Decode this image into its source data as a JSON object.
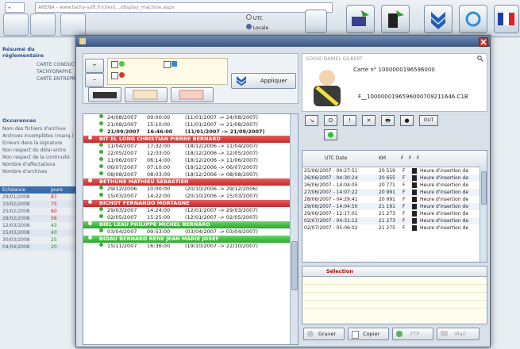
{
  "background": {
    "url_text": "ARENA - www.tachy-soft.fr/client.../display_machine.aspx",
    "utc_label": "UTC",
    "locale_label": "Locale",
    "resume_title": "Résumé du réglementaire",
    "resume_items": [
      "CARTE CONDUCTEUR",
      "TACHYGRAPHE",
      "CARTE ENTREPRISE"
    ],
    "occurrences_title": "Occurences",
    "occurrences_items": [
      "Nom des fichiers d'archive",
      "Archives incomplètes (manq.)",
      "Erreurs dans la signature",
      "Non respect du délai entre",
      "Non respect de la continuité",
      "Nombre d'affectations",
      "Nombre d'archives"
    ],
    "echeance_header": "Echéance",
    "jours_header": "Jours",
    "echeance_rows": [
      {
        "date": "29/01/2008",
        "days": "87"
      },
      {
        "date": "10/02/2008",
        "days": "75"
      },
      {
        "date": "25/02/2008",
        "days": "60"
      },
      {
        "date": "28/02/2008",
        "days": "56"
      },
      {
        "date": "12/03/2008",
        "days": "43"
      },
      {
        "date": "15/03/2008",
        "days": "40"
      },
      {
        "date": "30/03/2008",
        "days": "25"
      },
      {
        "date": "04/04/2008",
        "days": "20"
      }
    ]
  },
  "dialog": {
    "apply_label": "Appliquer",
    "driver_blur_name": "GOSSE DANIEL GILBERT",
    "card_label": "Carte n°",
    "card_number": "1000000196596000",
    "file_name": "F__1000000196596000709211646.C1B",
    "action_buttons": [
      "↘",
      "O",
      "!",
      "✕",
      "🖶",
      "●",
      "OUT"
    ],
    "left_list": [
      {
        "kind": "row",
        "date": "24/08/2007",
        "time": "09:00:00",
        "range": "(11/01/2007 -> 24/08/2007)"
      },
      {
        "kind": "row",
        "date": "21/08/2007",
        "time": "15:10:00",
        "range": "(11/01/2007 -> 21/08/2007)"
      },
      {
        "kind": "row",
        "date": "21/09/2007",
        "time": "16:46:00",
        "range": "(11/01/2007 -> 21/09/2007)",
        "bold": true
      },
      {
        "kind": "red",
        "label": "BIT EL LONG CHRISTIAN PIERRE BERNARD"
      },
      {
        "kind": "row",
        "date": "11/04/2007",
        "time": "17:32:00",
        "range": "(18/12/2006 -> 11/04/2007)"
      },
      {
        "kind": "row",
        "date": "12/05/2007",
        "time": "12:03:00",
        "range": "(18/12/2006 -> 12/05/2007)"
      },
      {
        "kind": "row",
        "date": "11/06/2007",
        "time": "06:14:00",
        "range": "(18/12/2006 -> 11/06/2007)"
      },
      {
        "kind": "row",
        "date": "06/07/2007",
        "time": "07:10:00",
        "range": "(18/12/2006 -> 06/07/2007)"
      },
      {
        "kind": "row",
        "date": "08/08/2007",
        "time": "08:03:00",
        "range": "(18/12/2006 -> 08/08/2007)"
      },
      {
        "kind": "red",
        "label": "BETHUNE MATHIEU SEBASTIEN"
      },
      {
        "kind": "row",
        "date": "29/12/2006",
        "time": "10:00:00",
        "range": "(20/10/2006 -> 29/12/2006)"
      },
      {
        "kind": "row",
        "date": "15/03/2007",
        "time": "14:22:00",
        "range": "(20/10/2006 -> 15/03/2007)"
      },
      {
        "kind": "red",
        "label": "BICHOT FERNANDO MORTAGNE"
      },
      {
        "kind": "row",
        "date": "29/03/2007",
        "time": "14:24:00",
        "range": "(12/01/2007 -> 29/03/2007)"
      },
      {
        "kind": "row",
        "date": "02/05/2007",
        "time": "15:25:00",
        "range": "(12/01/2007 -> 02/05/2007)"
      },
      {
        "kind": "green",
        "label": "BIEL LEAU PHILIPPE MICHEL BERNARD"
      },
      {
        "kind": "row",
        "date": "03/04/2007",
        "time": "09:53:00",
        "range": "(03/04/2007 -> 03/04/2007)"
      },
      {
        "kind": "green",
        "label": "BIDAU BERNARD RENE JEAN MARIE JOSEF"
      },
      {
        "kind": "row",
        "date": "15/11/2007",
        "time": "16:36:00",
        "range": "(19/10/2007 -> 22/10/2007)"
      }
    ],
    "table_headers": {
      "date": "UTC Date",
      "km": "KM",
      "f1": "F",
      "f2": "F",
      "f3": "F"
    },
    "table_rows": [
      {
        "date": "25/06/2007 - 04:27:51",
        "km": "20 519",
        "f": "F",
        "event": "Heure d'insertion de"
      },
      {
        "date": "26/06/2007 - 04:30:24",
        "km": "20 655",
        "f": "F",
        "event": "Heure d'insertion de"
      },
      {
        "date": "26/06/2007 - 14:04:05",
        "km": "20 771",
        "f": "F",
        "event": "Heure d'insertion de"
      },
      {
        "date": "27/06/2007 - 14:07:22",
        "km": "20 991",
        "f": "F",
        "event": "Heure d'insertion de"
      },
      {
        "date": "28/06/2007 - 04:29:41",
        "km": "20 991",
        "f": "F",
        "event": "Heure d'insertion de"
      },
      {
        "date": "29/06/2007 - 14:04:50",
        "km": "21 191",
        "f": "F",
        "event": "Heure d'insertion de"
      },
      {
        "date": "29/06/2007 - 12:17:01",
        "km": "21 273",
        "f": "F",
        "event": "Heure d'insertion de"
      },
      {
        "date": "02/07/2007 - 04:31:12",
        "km": "21 273",
        "f": "F",
        "event": "Heure d'insertion de"
      },
      {
        "date": "02/07/2007 - 05:06:02",
        "km": "21 275",
        "f": "F",
        "event": "Heure d'insertion de"
      }
    ],
    "selection_header": "Sélection",
    "bottom_buttons": {
      "burn": "Graver",
      "copy": "Copier",
      "ftp": "FTP",
      "mail": "Mail"
    },
    "colors": {
      "red_header": "#c22a2a",
      "green_header": "#2da62d",
      "titlebar": "#3a5683"
    }
  }
}
